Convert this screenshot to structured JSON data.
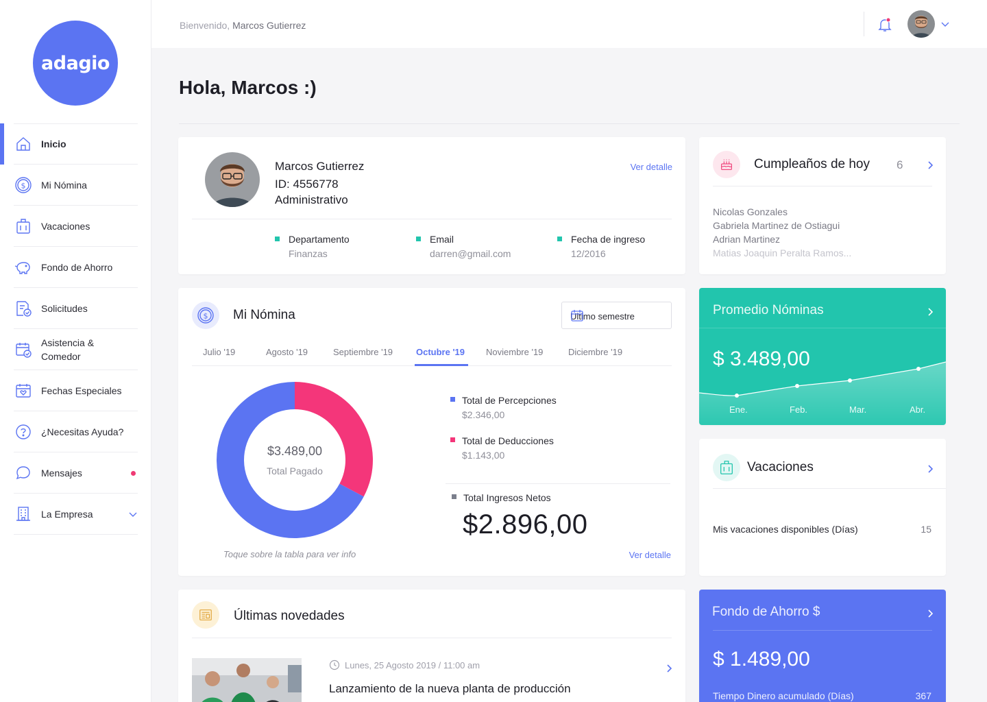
{
  "brand": {
    "logo_text": "adagio",
    "color": "#5b74f2"
  },
  "sidebar": {
    "items": [
      {
        "label": "Inicio",
        "icon": "home-icon",
        "active": true
      },
      {
        "label": "Mi Nómina",
        "icon": "dollar-circle-icon"
      },
      {
        "label": "Vacaciones",
        "icon": "luggage-icon"
      },
      {
        "label": "Fondo de Ahorro",
        "icon": "piggy-bank-icon"
      },
      {
        "label": "Solicitudes",
        "icon": "document-check-icon"
      },
      {
        "label_line1": "Asistencia &",
        "label_line2": "Comedor",
        "icon": "calendar-check-icon"
      },
      {
        "label": "Fechas Especiales",
        "icon": "calendar-heart-icon"
      },
      {
        "label": "¿Necesitas Ayuda?",
        "icon": "help-circle-icon"
      },
      {
        "label": "Mensajes",
        "icon": "chat-bubble-icon",
        "badge_color": "#ef3a74"
      },
      {
        "label": "La Empresa",
        "icon": "building-icon"
      }
    ]
  },
  "header": {
    "welcome_prefix": "Bienvenido,",
    "user_name": "Marcos Gutierrez",
    "notification_color": "#ef3a74"
  },
  "page": {
    "title": "Hola, Marcos :)"
  },
  "profile": {
    "name": "Marcos Gutierrez",
    "id": "ID: 4556778",
    "role": "Administrativo",
    "link": "Ver detalle",
    "fields": [
      {
        "label": "Departamento",
        "value": "Finanzas"
      },
      {
        "label": "Email",
        "value": "darren@gmail.com"
      },
      {
        "label": "Fecha de ingreso",
        "value": "12/2016"
      }
    ]
  },
  "birthdays": {
    "title": "Cumpleaños de hoy",
    "count": "6",
    "names": [
      "Nicolas Gonzales",
      "Gabriela Martinez de Ostiagui",
      "Adrian Martinez",
      "Matias Joaquin Peralta Ramos..."
    ]
  },
  "nomina": {
    "title": "Mi Nómina",
    "period_select": "Ultimo semestre",
    "tabs": [
      "Julio '19",
      "Agosto '19",
      "Septiembre '19",
      "Octubre '19",
      "Noviembre '19",
      "Diciembre '19"
    ],
    "active_tab": "Octubre '19",
    "donut_amount": "$3.489,00",
    "donut_caption": "Total Pagado",
    "hint": "Toque sobre la tabla para ver info",
    "percepciones_label": "Total de Percepciones",
    "percepciones_value": "$2.346,00",
    "deducciones_label": "Total de Deducciones",
    "deducciones_value": "$1.143,00",
    "neto_label": "Total Ingresos Netos",
    "neto_value": "$2.896,00",
    "link": "Ver detalle",
    "colors": {
      "percepciones": "#5b74f2",
      "deducciones": "#f4367a",
      "neto": "#7b7f8c"
    }
  },
  "chart_data": {
    "type": "pie",
    "labels": [
      "Total de Percepciones",
      "Total de Deducciones"
    ],
    "values": [
      2346,
      1143
    ],
    "colors": [
      "#5b74f2",
      "#f4367a"
    ]
  },
  "promedio": {
    "title": "Promedio Nóminas",
    "amount": "$ 3.489,00",
    "months": [
      "Ene.",
      "Feb.",
      "Mar.",
      "Abr."
    ],
    "color": "#22c5ad"
  },
  "vacaciones": {
    "title": "Vacaciones",
    "label": "Mis vacaciones disponibles (Días)",
    "value": "15"
  },
  "novedades": {
    "title": "Últimas novedades",
    "date": "Lunes, 25 Agosto 2019 / 11:00 am",
    "headline": "Lanzamiento de la nueva planta de producción"
  },
  "fondo": {
    "title": "Fondo de Ahorro $",
    "amount": "$ 1.489,00",
    "label": "Tiempo Dinero acumulado (Días)",
    "value": "367",
    "color": "#5b74f2"
  }
}
